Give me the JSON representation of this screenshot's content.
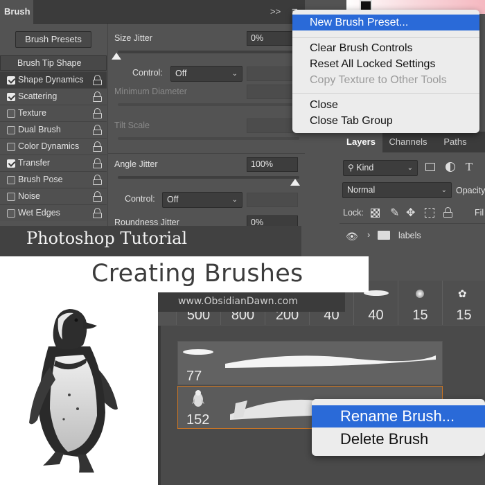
{
  "brush_panel": {
    "tab_title": "Brush",
    "collapse_glyph": ">>",
    "menu_glyph": "≡",
    "presets_button": "Brush Presets",
    "tip_shape": "Brush Tip Shape",
    "options": [
      {
        "label": "Shape Dynamics",
        "checked": true,
        "selected": true
      },
      {
        "label": "Scattering",
        "checked": true,
        "selected": false
      },
      {
        "label": "Texture",
        "checked": false,
        "selected": false
      },
      {
        "label": "Dual Brush",
        "checked": false,
        "selected": false
      },
      {
        "label": "Color Dynamics",
        "checked": false,
        "selected": false
      },
      {
        "label": "Transfer",
        "checked": true,
        "selected": false
      },
      {
        "label": "Brush Pose",
        "checked": false,
        "selected": false
      },
      {
        "label": "Noise",
        "checked": false,
        "selected": false
      },
      {
        "label": "Wet Edges",
        "checked": false,
        "selected": false
      }
    ],
    "size_jitter": {
      "label": "Size Jitter",
      "value": "0%",
      "slider": 0.0
    },
    "control1": {
      "label": "Control:",
      "value": "Off"
    },
    "min_diameter": {
      "label": "Minimum Diameter"
    },
    "tilt_scale": {
      "label": "Tilt Scale"
    },
    "angle_jitter": {
      "label": "Angle Jitter",
      "value": "100%",
      "slider": 1.0
    },
    "control2": {
      "label": "Control:",
      "value": "Off"
    },
    "roundness_jitter": {
      "label": "Roundness Jitter",
      "value": "0%"
    }
  },
  "flyout_menu": {
    "items": [
      {
        "label": "New Brush Preset...",
        "state": "highlighted"
      },
      {
        "label": "Clear Brush Controls",
        "state": "normal"
      },
      {
        "label": "Reset All Locked Settings",
        "state": "normal"
      },
      {
        "label": "Copy Texture to Other Tools",
        "state": "disabled"
      },
      {
        "label": "Close",
        "state": "normal"
      },
      {
        "label": "Close Tab Group",
        "state": "normal"
      }
    ]
  },
  "layers_panel": {
    "tabs": [
      "Layers",
      "Channels",
      "Paths"
    ],
    "kind_label": "Kind",
    "blend_mode": "Normal",
    "opacity_label": "Opacity",
    "lock_label": "Lock:",
    "fill_label": "Fil",
    "layer_name": "labels"
  },
  "titles": {
    "tutorial": "Photoshop Tutorial",
    "main": "Creating Brushes",
    "url": "www.ObsidianDawn.com"
  },
  "brush_presets": {
    "thumb_sizes": [
      "500",
      "800",
      "200",
      "40",
      "40",
      "15",
      "15"
    ],
    "rows": [
      {
        "size": "77",
        "selected": false
      },
      {
        "size": "152",
        "selected": true
      }
    ]
  },
  "context_menu": {
    "items": [
      {
        "label": "Rename Brush...",
        "state": "highlighted"
      },
      {
        "label": "Delete Brush",
        "state": "normal"
      }
    ]
  },
  "colors": {
    "highlight": "#2a6ad8",
    "panel_bg": "#535353",
    "selected_border": "#c97424"
  }
}
